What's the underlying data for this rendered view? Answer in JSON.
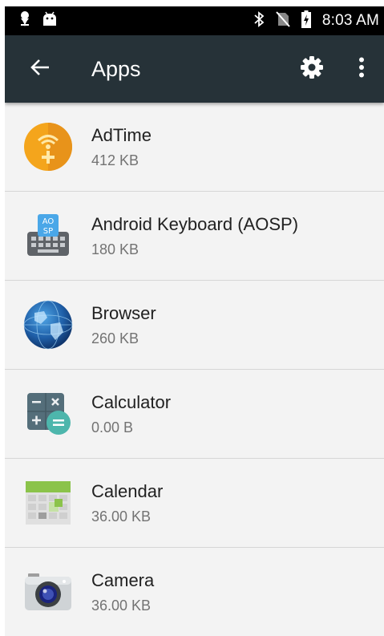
{
  "status_bar": {
    "time": "8:03 AM",
    "left_icons": [
      "location-pin-icon",
      "android-debug-icon"
    ],
    "right_icons": [
      "bluetooth-icon",
      "no-sim-icon",
      "battery-charging-icon"
    ]
  },
  "app_bar": {
    "title": "Apps",
    "background_color": "#263238",
    "icons": [
      "back-arrow-icon",
      "gear-icon",
      "more-vert-icon"
    ]
  },
  "apps": [
    {
      "name": "AdTime",
      "size": "412 KB",
      "icon": "adtime-icon"
    },
    {
      "name": "Android Keyboard (AOSP)",
      "size": "180 KB",
      "icon": "keyboard-icon"
    },
    {
      "name": "Browser",
      "size": "260 KB",
      "icon": "browser-globe-icon"
    },
    {
      "name": "Calculator",
      "size": "0.00 B",
      "icon": "calculator-icon"
    },
    {
      "name": "Calendar",
      "size": "36.00 KB",
      "icon": "calendar-icon"
    },
    {
      "name": "Camera",
      "size": "36.00 KB",
      "icon": "camera-icon"
    }
  ]
}
